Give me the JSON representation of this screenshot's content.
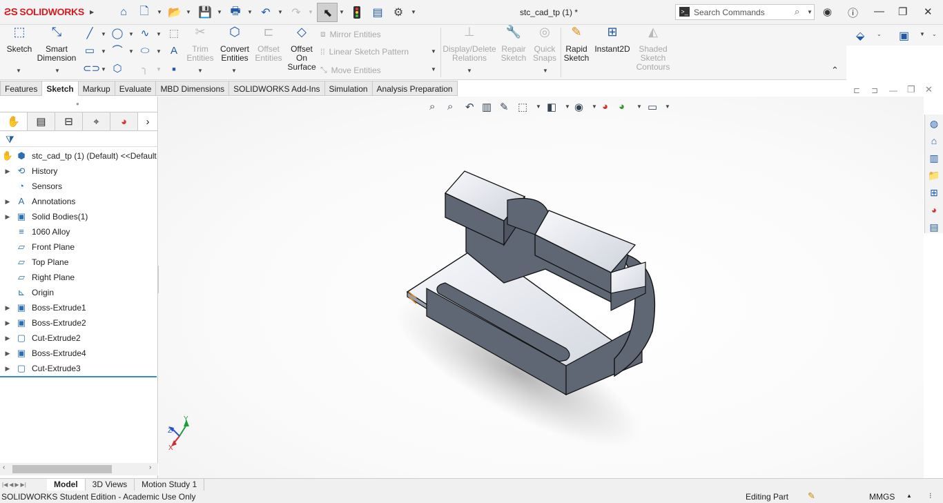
{
  "app": {
    "brand": "SOLIDWORKS",
    "document_title": "stc_cad_tp (1) *"
  },
  "search": {
    "placeholder": "Search Commands"
  },
  "ribbon": {
    "sketch": "Sketch",
    "smart_dimension": [
      "Smart",
      "Dimension"
    ],
    "trim_entities": [
      "Trim",
      "Entities"
    ],
    "convert_entities": [
      "Convert",
      "Entities"
    ],
    "offset_entities": [
      "Offset",
      "Entities"
    ],
    "offset_on_surface": [
      "Offset",
      "On",
      "Surface"
    ],
    "mirror_entities": "Mirror Entities",
    "linear_sketch_pattern": "Linear Sketch Pattern",
    "move_entities": "Move Entities",
    "display_delete_relations": [
      "Display/Delete",
      "Relations"
    ],
    "repair_sketch": [
      "Repair",
      "Sketch"
    ],
    "quick_snaps": [
      "Quick",
      "Snaps"
    ],
    "rapid_sketch": [
      "Rapid",
      "Sketch"
    ],
    "instant2d": "Instant2D",
    "shaded_sketch_contours": [
      "Shaded",
      "Sketch",
      "Contours"
    ]
  },
  "tabs": [
    "Features",
    "Sketch",
    "Markup",
    "Evaluate",
    "MBD Dimensions",
    "SOLIDWORKS Add-Ins",
    "Simulation",
    "Analysis Preparation"
  ],
  "active_tab": "Sketch",
  "tree": [
    {
      "label": "stc_cad_tp (1) (Default) <<Default",
      "icon": "part-icon",
      "expandable": false
    },
    {
      "label": "History",
      "icon": "history-icon",
      "expandable": true
    },
    {
      "label": "Sensors",
      "icon": "sensors-icon",
      "expandable": false
    },
    {
      "label": "Annotations",
      "icon": "annotations-icon",
      "expandable": true
    },
    {
      "label": "Solid Bodies(1)",
      "icon": "solid-bodies-icon",
      "expandable": true
    },
    {
      "label": "1060 Alloy",
      "icon": "material-icon",
      "expandable": false
    },
    {
      "label": "Front Plane",
      "icon": "plane-icon",
      "expandable": false
    },
    {
      "label": "Top Plane",
      "icon": "plane-icon",
      "expandable": false
    },
    {
      "label": "Right Plane",
      "icon": "plane-icon",
      "expandable": false
    },
    {
      "label": "Origin",
      "icon": "origin-icon",
      "expandable": false
    },
    {
      "label": "Boss-Extrude1",
      "icon": "boss-extrude-icon",
      "expandable": true
    },
    {
      "label": "Boss-Extrude2",
      "icon": "boss-extrude-icon",
      "expandable": true
    },
    {
      "label": "Cut-Extrude2",
      "icon": "cut-extrude-icon",
      "expandable": true
    },
    {
      "label": "Boss-Extrude4",
      "icon": "boss-extrude-icon",
      "expandable": true
    },
    {
      "label": "Cut-Extrude3",
      "icon": "cut-extrude-icon",
      "expandable": true
    }
  ],
  "bottom_tabs": [
    "Model",
    "3D Views",
    "Motion Study 1"
  ],
  "status": {
    "left": "SOLIDWORKS Student Edition - Academic Use Only",
    "mode": "Editing Part",
    "units": "MMGS"
  },
  "triad": {
    "x": "X",
    "y": "Y",
    "z": "Z"
  },
  "colors": {
    "brand": "#d71920",
    "accent": "#1e5aa8",
    "part_face": "#5f6674",
    "part_top": "#e9ecf2"
  }
}
